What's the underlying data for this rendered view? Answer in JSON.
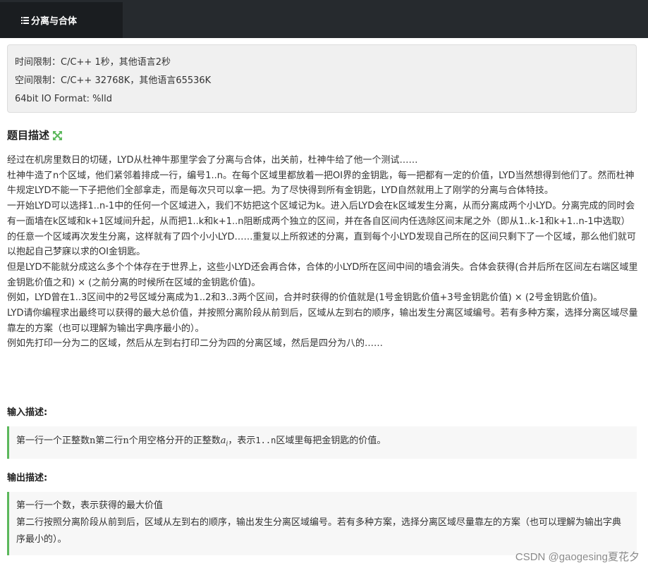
{
  "tab": {
    "label": "分离与合体"
  },
  "limits": {
    "time": "时间限制：C/C++ 1秒，其他语言2秒",
    "space": "空间限制：C/C++ 32768K，其他语言65536K",
    "format": "64bit IO Format: %lld"
  },
  "description": {
    "title": "题目描述",
    "paragraphs": [
      "经过在机房里数日的切磋，LYD从杜神牛那里学会了分离与合体，出关前，杜神牛给了他一个测试……",
      "杜神牛造了n个区域，他们紧邻着排成一行，编号1..n。在每个区域里都放着一把OI界的金钥匙，每一把都有一定的价值，LYD当然想得到他们了。然而杜神牛规定LYD不能一下子把他们全部拿走，而是每次只可以拿一把。为了尽快得到所有金钥匙，LYD自然就用上了刚学的分离与合体特技。",
      "一开始LYD可以选择1..n-1中的任何一个区域进入，我们不妨把这个区域记为k。进入后LYD会在k区域发生分离，从而分离成两个小LYD。分离完成的同时会有一面墙在k区域和k+1区域间升起，从而把1..k和k+1..n阻断成两个独立的区间，并在各自区间内任选除区间末尾之外（即从1..k-1和k+1..n-1中选取）的任意一个区域再次发生分离，这样就有了四个小小LYD……重复以上所叙述的分离，直到每个小LYD发现自己所在的区间只剩下了一个区域，那么他们就可以抱起自己梦寐以求的OI金钥匙。",
      "但是LYD不能就分成这么多个个体存在于世界上，这些小LYD还会再合体，合体的小LYD所在区间中间的墙会消失。合体会获得(合并后所在区间左右端区域里金钥匙价值之和) × (之前分离的时候所在区域的金钥匙价值)。",
      "例如，LYD曾在1..3区间中的2号区域分离成为1..2和3..3两个区间，合并时获得的价值就是(1号金钥匙价值+3号金钥匙价值) × (2号金钥匙价值)。",
      "LYD请你编程求出最终可以获得的最大总价值，并按照分离阶段从前到后，区域从左到右的顺序，输出发生分离区域编号。若有多种方案，选择分离区域尽量靠左的方案（也可以理解为输出字典序最小的）。",
      "例如先打印一分为二的区域，然后从左到右打印二分为四的分离区域，然后是四分为八的……"
    ]
  },
  "input": {
    "title": "输入描述:",
    "text_a": "第一行一个正整数n第二行n个用空格分开的正整数",
    "math": "a",
    "sub": "i",
    "text_b": "，表示",
    "code": "1..n",
    "text_c": "区域里每把金钥匙的价值。"
  },
  "output": {
    "title": "输出描述:",
    "lines": [
      "第一行一个数，表示获得的最大价值",
      "第二行按照分离阶段从前到后，区域从左到右的顺序，输出发生分离区域编号。若有多种方案，选择分离区域尽量靠左的方案（也可以理解为输出字典序最小的）。"
    ]
  },
  "watermark": "CSDN @gaogesing夏花夕",
  "colors": {
    "topbar": "#262a2e",
    "tab": "#1a1d20",
    "accent_green": "#5cb85c"
  },
  "icons": {
    "tab": "list-icon",
    "title": "expand-icon"
  }
}
